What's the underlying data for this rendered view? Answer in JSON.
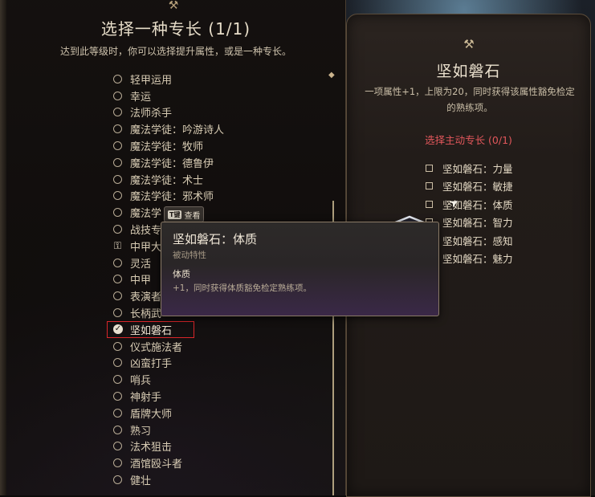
{
  "left_panel": {
    "title": "选择一种专长 (1/1)",
    "subtitle": "达到此等级时，你可以选择提升属性，或是一种专长。",
    "feats": [
      {
        "label": "轻甲运用",
        "state": "normal"
      },
      {
        "label": "幸运",
        "state": "normal"
      },
      {
        "label": "法师杀手",
        "state": "normal"
      },
      {
        "label": "魔法学徒：吟游诗人",
        "state": "normal"
      },
      {
        "label": "魔法学徒：牧师",
        "state": "normal"
      },
      {
        "label": "魔法学徒：德鲁伊",
        "state": "normal"
      },
      {
        "label": "魔法学徒：术士",
        "state": "normal"
      },
      {
        "label": "魔法学徒：邪术师",
        "state": "normal"
      },
      {
        "label": "魔法学",
        "state": "normal"
      },
      {
        "label": "战技专",
        "state": "normal"
      },
      {
        "label": "中甲大",
        "state": "locked"
      },
      {
        "label": "灵活",
        "state": "normal"
      },
      {
        "label": "中甲",
        "state": "normal"
      },
      {
        "label": "表演者",
        "state": "normal"
      },
      {
        "label": "长柄武",
        "state": "normal"
      },
      {
        "label": "坚如磐石",
        "state": "selected"
      },
      {
        "label": "仪式施法者",
        "state": "normal"
      },
      {
        "label": "凶蛮打手",
        "state": "normal"
      },
      {
        "label": "哨兵",
        "state": "normal"
      },
      {
        "label": "神射手",
        "state": "normal"
      },
      {
        "label": "盾牌大师",
        "state": "normal"
      },
      {
        "label": "熟习",
        "state": "normal"
      },
      {
        "label": "法术狙击",
        "state": "normal"
      },
      {
        "label": "酒馆殴斗者",
        "state": "normal"
      },
      {
        "label": "健壮",
        "state": "normal"
      }
    ]
  },
  "right_panel": {
    "title": "坚如磐石",
    "description": "一项属性+1，上限为20，同时获得该属性豁免检定的熟练项。",
    "choose_heading": "选择主动专长 (0/1)",
    "options": [
      "坚如磐石：力量",
      "坚如磐石：敏捷",
      "坚如磐石：体质",
      "坚如磐石：智力",
      "坚如磐石：感知",
      "坚如磐石：魅力"
    ]
  },
  "tooltip": {
    "key_hint": "T键",
    "key_action": "查看",
    "title": "坚如磐石：体质",
    "subtitle": "被动特性",
    "section": "体质",
    "body": "+1，同时获得体质豁免检定熟练项。"
  },
  "colors": {
    "selection_outline": "#d8262a",
    "heading_red": "#e2575b",
    "tooltip_purple": "#3a2847"
  },
  "icons": {
    "ornament": "hammer-ornament-icon",
    "lock": "lock-icon",
    "check": "checkmark-icon",
    "emblem": "shield-emblem-icon",
    "cursor": "mouse-cursor-icon"
  }
}
